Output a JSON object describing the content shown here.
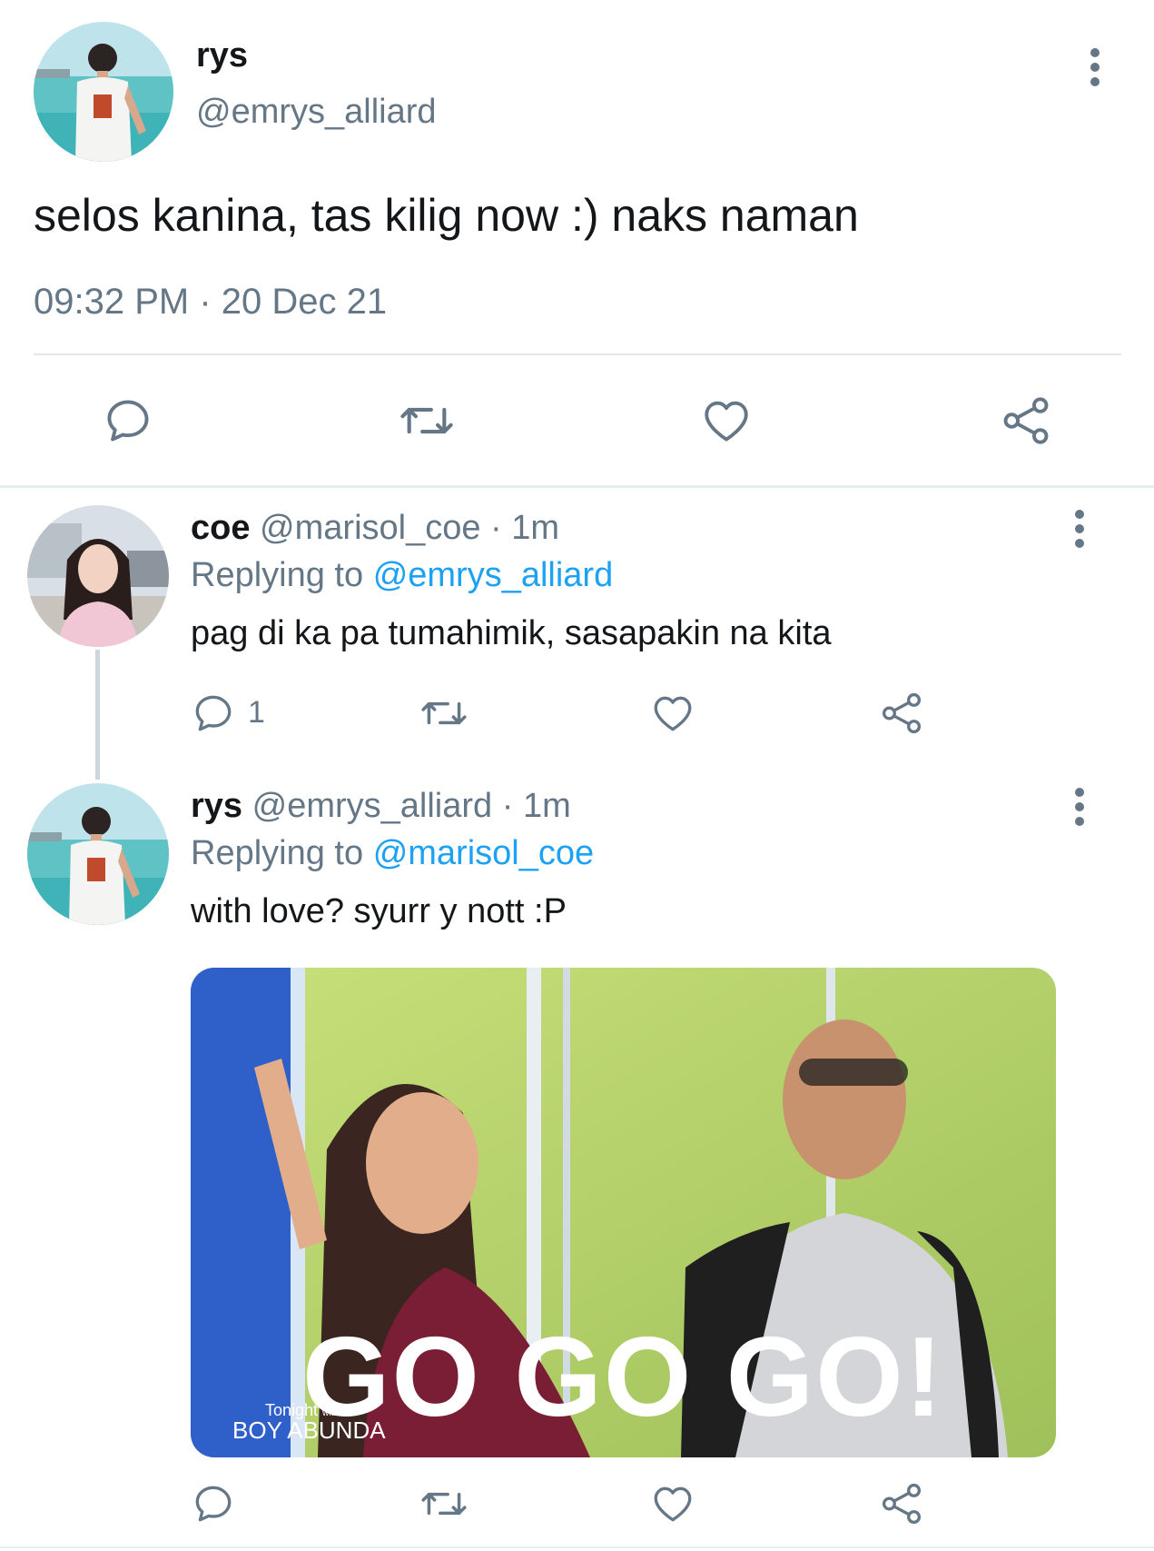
{
  "main_tweet": {
    "display_name": "rys",
    "handle": "@emrys_alliard",
    "text": "selos kanina, tas kilig now :) naks naman",
    "time": "09:32 PM",
    "separator": "·",
    "date": "20 Dec 21",
    "actions": [
      "reply-icon",
      "retweet-icon",
      "like-icon",
      "share-icon"
    ]
  },
  "replies": [
    {
      "display_name": "coe",
      "handle": "@marisol_coe",
      "separator": "·",
      "time_ago": "1m",
      "replying_prefix": "Replying to",
      "replying_to": "@emrys_alliard",
      "text": "pag di ka pa tumahimik, sasapakin na kita",
      "reply_count": "1"
    },
    {
      "display_name": "rys",
      "handle": "@emrys_alliard",
      "separator": "·",
      "time_ago": "1m",
      "replying_prefix": "Replying to",
      "replying_to": "@marisol_coe",
      "text": "with love? syurr y nott :P",
      "media": {
        "caption": "GO GO GO!",
        "watermark_top": "Tonight",
        "watermark_with": "with",
        "watermark_bottom": "BOY ABUNDA"
      }
    }
  ],
  "colors": {
    "text": "#14171a",
    "muted": "#657786",
    "link": "#1da1f2",
    "divider": "#e1e8ed"
  }
}
